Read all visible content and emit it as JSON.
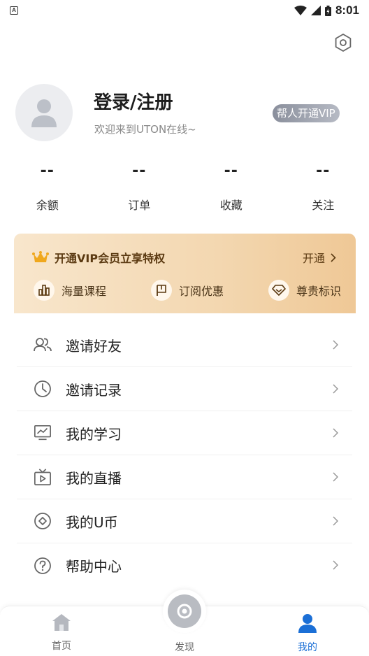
{
  "status_bar": {
    "notification_icon": "A",
    "time": "8:01"
  },
  "profile": {
    "title": "登录/注册",
    "subtitle": "欢迎来到UTON在线~",
    "vip_button": "帮人开通VIP"
  },
  "stats": [
    {
      "value": "--",
      "label": "余额"
    },
    {
      "value": "--",
      "label": "订单"
    },
    {
      "value": "--",
      "label": "收藏"
    },
    {
      "value": "--",
      "label": "关注"
    }
  ],
  "vip_card": {
    "title": "开通VIP会员立享特权",
    "open_label": "开通",
    "features": [
      {
        "label": "海量课程",
        "icon": "bar-chart-icon"
      },
      {
        "label": "订阅优惠",
        "icon": "flag-icon"
      },
      {
        "label": "尊贵标识",
        "icon": "diamond-icon"
      }
    ]
  },
  "menu": [
    {
      "label": "邀请好友",
      "icon": "friends-icon"
    },
    {
      "label": "邀请记录",
      "icon": "clock-icon"
    },
    {
      "label": "我的学习",
      "icon": "study-icon"
    },
    {
      "label": "我的直播",
      "icon": "tv-icon"
    },
    {
      "label": "我的U币",
      "icon": "coin-icon"
    },
    {
      "label": "帮助中心",
      "icon": "help-icon"
    }
  ],
  "tabbar": {
    "home": "首页",
    "discover": "发现",
    "mine": "我的",
    "active": "mine"
  },
  "colors": {
    "accent": "#1b6fd6",
    "vip_gold": "#efc896",
    "vip_text": "#5b3a12"
  }
}
